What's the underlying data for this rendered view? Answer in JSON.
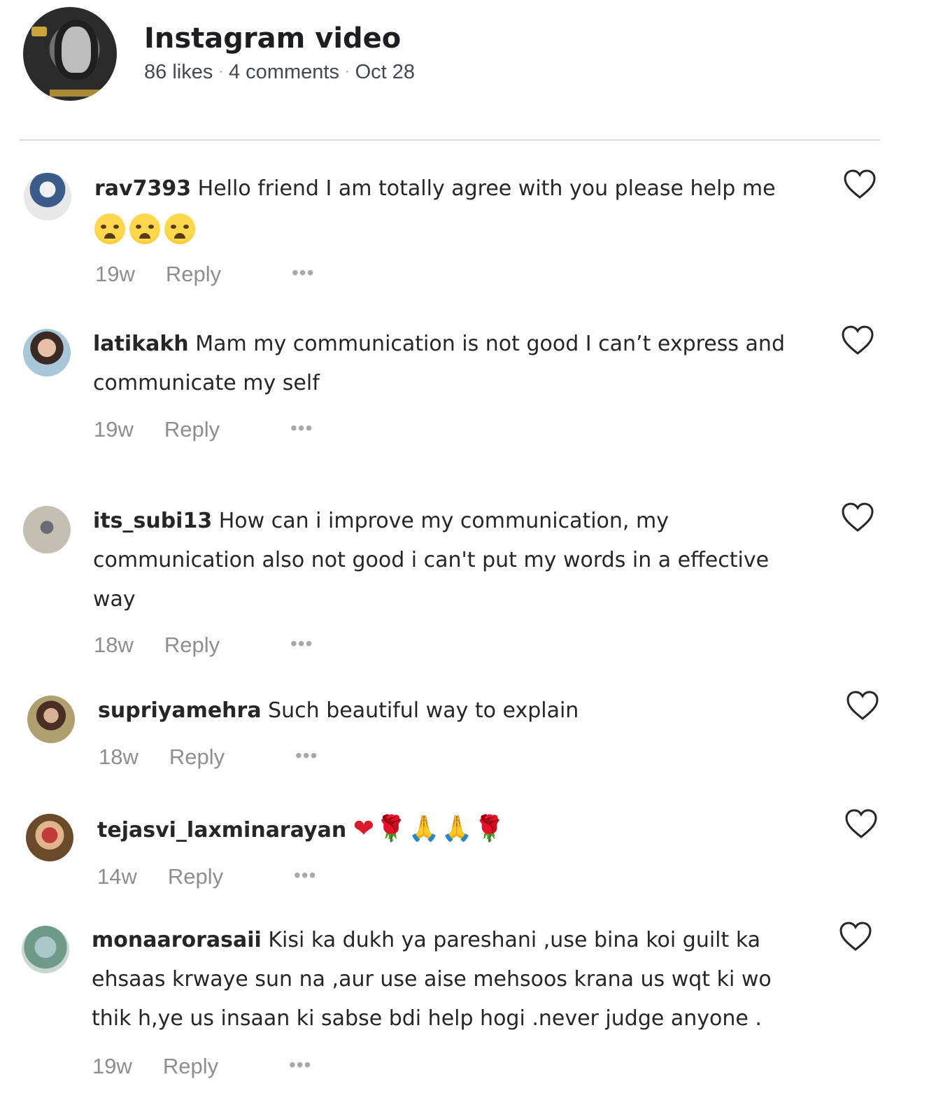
{
  "post": {
    "title": "Instagram video",
    "likes": "86 likes",
    "comments_count": "4 comments",
    "date": "Oct 28",
    "separator": "·"
  },
  "comments": [
    {
      "username": "rav7393",
      "text": "Hello friend I am totally agree with you please help me",
      "emojis": [
        "crying-face",
        "crying-face",
        "crying-face"
      ],
      "age": "19w",
      "reply_label": "Reply",
      "more_label": "•••"
    },
    {
      "username": "latikakh",
      "text": "Mam my communication is not good I can’t express and communicate my self",
      "age": "19w",
      "reply_label": "Reply",
      "more_label": "•••"
    },
    {
      "username": "its_subi13",
      "text": "How can i improve my communication, my communication also not good i can't put my words in a effective way",
      "age": "18w",
      "reply_label": "Reply",
      "more_label": "•••"
    },
    {
      "username": "supriyamehra",
      "text": "Such beautiful way to explain",
      "age": "18w",
      "reply_label": "Reply",
      "more_label": "•••"
    },
    {
      "username": "tejasvi_laxminarayan",
      "text": "",
      "emojis": [
        "red-heart",
        "rose",
        "folded-hands",
        "folded-hands",
        "rose"
      ],
      "emoji_glyphs": "❤🌹🙏🙏🌹",
      "age": "14w",
      "reply_label": "Reply",
      "more_label": "•••"
    },
    {
      "username": "monaarorasaii",
      "text": "Kisi ka dukh ya pareshani ,use bina koi guilt ka ehsaas krwaye sun na ,aur use aise mehsoos krana us wqt ki wo thik h,ye us insaan ki sabse bdi help hogi .never judge anyone .",
      "age": "19w",
      "reply_label": "Reply",
      "more_label": "•••"
    }
  ]
}
